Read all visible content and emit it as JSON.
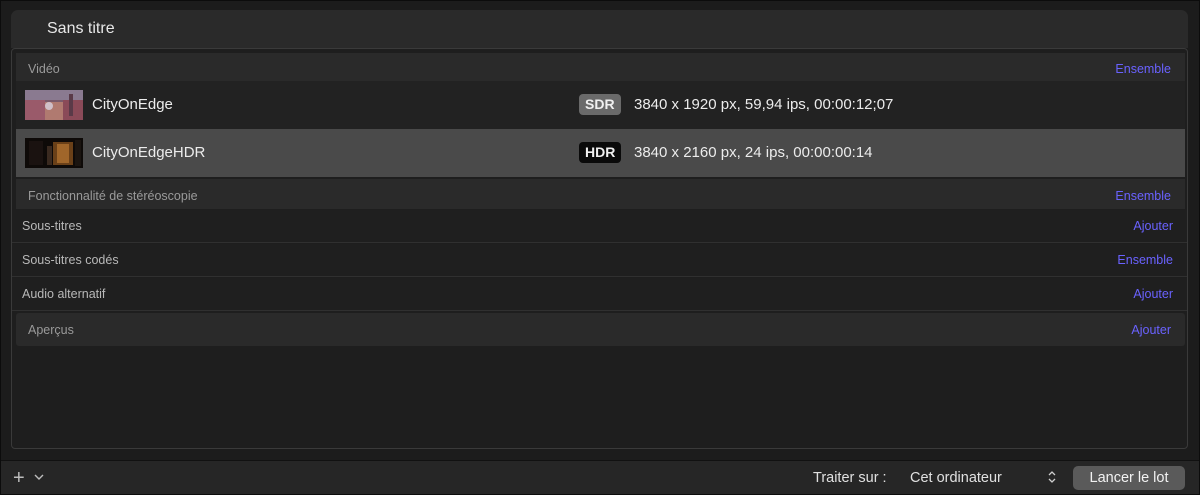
{
  "window": {
    "title": "Sans titre"
  },
  "video": {
    "header": "Vidéo",
    "action": "Ensemble",
    "items": [
      {
        "name": "CityOnEdge",
        "badge": "SDR",
        "meta": "3840 x 1920 px, 59,94 ips, 00:00:12;07",
        "selected": false
      },
      {
        "name": "CityOnEdgeHDR",
        "badge": "HDR",
        "meta": "3840 x 2160 px, 24 ips, 00:00:00:14",
        "selected": true
      }
    ]
  },
  "stereo": {
    "header": "Fonctionnalité de stéréoscopie",
    "action": "Ensemble"
  },
  "rows": [
    {
      "label": "Sous-titres",
      "action": "Ajouter"
    },
    {
      "label": "Sous-titres codés",
      "action": "Ensemble"
    },
    {
      "label": "Audio alternatif",
      "action": "Ajouter"
    }
  ],
  "previews": {
    "header": "Aperçus",
    "action": "Ajouter"
  },
  "bottombar": {
    "add_icon": "plus-icon",
    "process_label": "Traiter sur :",
    "process_value": "Cet ordinateur",
    "launch_label": "Lancer le lot"
  },
  "colors": {
    "accent": "#6a62ff",
    "selected_row": "#4a4a4a"
  }
}
